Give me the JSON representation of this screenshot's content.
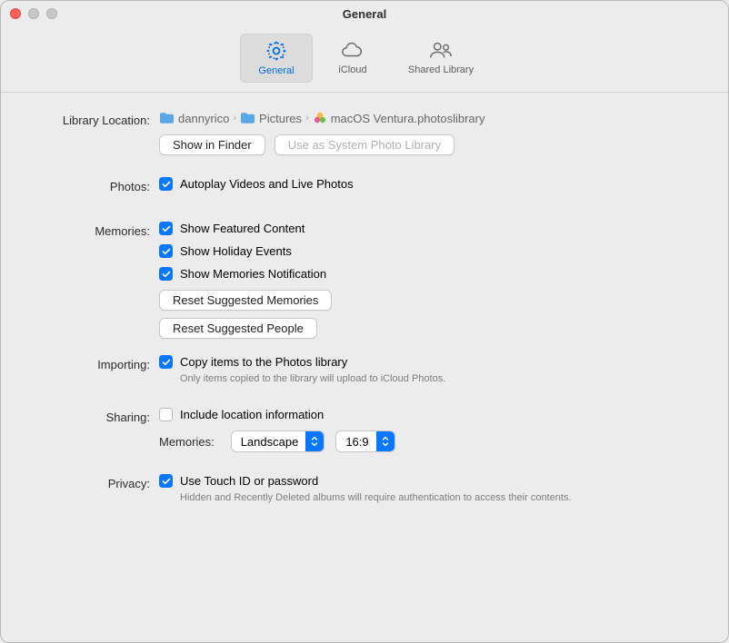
{
  "window_title": "General",
  "toolbar": {
    "items": [
      {
        "label": "General",
        "selected": true,
        "icon": "gear"
      },
      {
        "label": "iCloud",
        "selected": false,
        "icon": "cloud"
      },
      {
        "label": "Shared Library",
        "selected": false,
        "icon": "people"
      }
    ]
  },
  "library_location": {
    "label": "Library Location:",
    "crumbs": [
      {
        "name": "dannyrico",
        "icon": "folder"
      },
      {
        "name": "Pictures",
        "icon": "folder"
      },
      {
        "name": "macOS Ventura.photoslibrary",
        "icon": "photoslib"
      }
    ],
    "show_in_finder": "Show in Finder",
    "use_system": "Use as System Photo Library"
  },
  "photos": {
    "label": "Photos:",
    "autoplay": "Autoplay Videos and Live Photos"
  },
  "memories": {
    "label": "Memories:",
    "featured": "Show Featured Content",
    "holiday": "Show Holiday Events",
    "notification": "Show Memories Notification",
    "reset_memories": "Reset Suggested Memories",
    "reset_people": "Reset Suggested People"
  },
  "importing": {
    "label": "Importing:",
    "copy_items": "Copy items to the Photos library",
    "help": "Only items copied to the library will upload to iCloud Photos."
  },
  "sharing": {
    "label": "Sharing:",
    "include_location": "Include location information",
    "memories_label": "Memories:",
    "orientation": "Landscape",
    "aspect": "16:9"
  },
  "privacy": {
    "label": "Privacy:",
    "touch_id": "Use Touch ID or password",
    "help": "Hidden and Recently Deleted albums will require authentication to access their contents."
  }
}
